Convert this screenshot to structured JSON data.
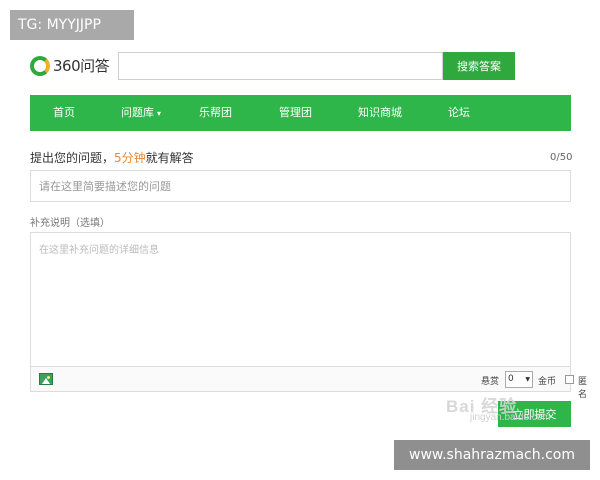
{
  "watermarks": {
    "top_left": "TG: MYYJJPP",
    "bottom_right": "www.shahrazmach.com",
    "baidu": "Bai 经验",
    "baidu_sub": "jingyan.baidu.com"
  },
  "header": {
    "logo_text": "360问答",
    "search_placeholder": "",
    "search_button": "搜索答案"
  },
  "nav": {
    "items": [
      {
        "label": "首页"
      },
      {
        "label": "问题库",
        "has_dropdown": true
      },
      {
        "label": "乐帮团"
      },
      {
        "label": "管理团"
      },
      {
        "label": "知识商城"
      },
      {
        "label": "论坛"
      }
    ]
  },
  "question": {
    "heading_prefix": "提出您的问题，",
    "heading_highlight": "5分钟",
    "heading_suffix": "就有解答",
    "counter": "0/50",
    "input_placeholder": "请在这里简要描述您的问题"
  },
  "detail": {
    "label": "补充说明（选填）",
    "placeholder": "在这里补充问题的详细信息"
  },
  "toolbar": {
    "image_icon": "image-icon",
    "reward_label": "悬赏",
    "reward_value": "0",
    "coin_label": "金币",
    "anonymous_label": "匿名",
    "anonymous_checked": false
  },
  "submit": {
    "label": "立即提交"
  },
  "colors": {
    "brand_green": "#2fb64a",
    "accent_orange": "#e8893a"
  }
}
